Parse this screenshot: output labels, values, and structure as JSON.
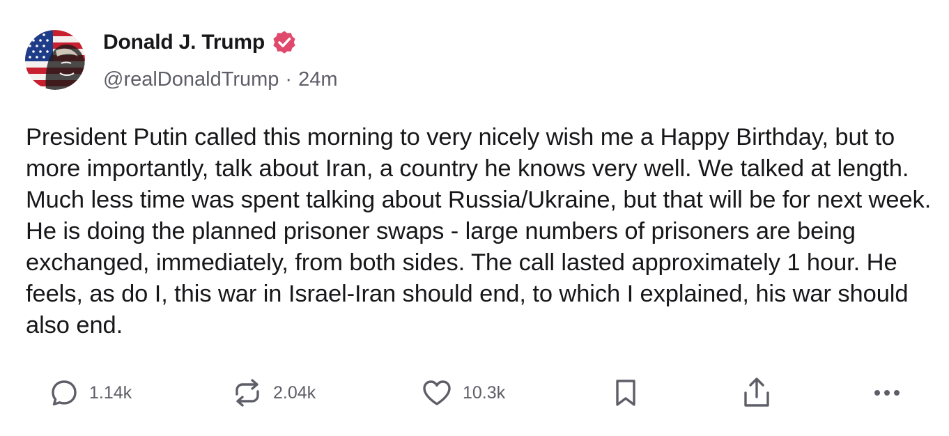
{
  "author": {
    "display_name": "Donald J. Trump",
    "handle": "@realDonaldTrump",
    "separator": "·",
    "time_ago": "24m",
    "verified": true
  },
  "post": {
    "text": "President Putin called this morning to very nicely wish me a Happy Birthday, but to more importantly, talk about Iran, a country he knows very well. We talked at length. Much less time was spent talking about Russia/Ukraine, but that will be for next week. He is doing the planned prisoner swaps - large numbers of prisoners are being exchanged, immediately, from both sides. The call lasted approximately 1 hour. He feels, as do I, this war in Israel-Iran should end, to which I explained, his war should also end."
  },
  "actions": {
    "reply": {
      "icon": "reply-bubble-icon",
      "count": "1.14k"
    },
    "retruth": {
      "icon": "retruth-icon",
      "count": "2.04k"
    },
    "like": {
      "icon": "heart-icon",
      "count": "10.3k"
    },
    "bookmark": {
      "icon": "bookmark-icon"
    },
    "share": {
      "icon": "share-icon"
    },
    "more": {
      "icon": "more-dots-icon"
    }
  },
  "colors": {
    "text": "#17171a",
    "muted": "#5e5e68",
    "verified_badge": "#e0486c"
  }
}
